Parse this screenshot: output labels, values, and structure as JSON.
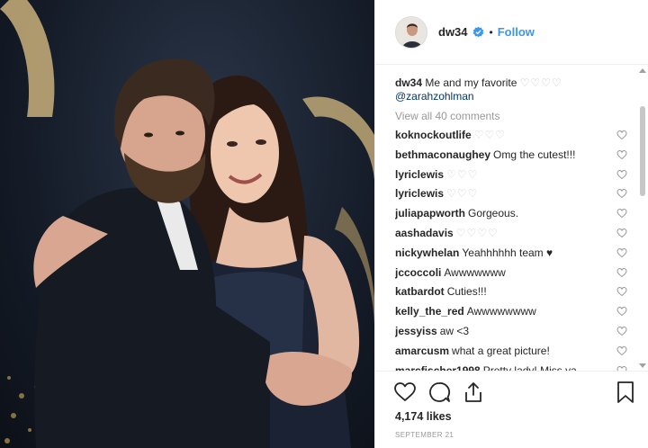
{
  "header": {
    "username": "dw34",
    "separator": "•",
    "follow_label": "Follow"
  },
  "caption": {
    "username": "dw34",
    "text": "Me and my favorite",
    "emoji": "♡♡♡♡",
    "mention": "@zarahzohlman"
  },
  "view_all": "View all 40 comments",
  "comments": [
    {
      "user": "koknockoutlife",
      "text": "♡♡♡",
      "faded": true
    },
    {
      "user": "bethmaconaughey",
      "text": "Omg the cutest!!!",
      "faded": false
    },
    {
      "user": "lyriclewis",
      "text": "♡♡♡",
      "faded": true
    },
    {
      "user": "lyriclewis",
      "text": "♡♡♡",
      "faded": true
    },
    {
      "user": "juliapapworth",
      "text": "Gorgeous.",
      "faded": false
    },
    {
      "user": "aashadavis",
      "text": "♡♡♡♡",
      "faded": true
    },
    {
      "user": "nickywhelan",
      "text": "Yeahhhhhh team ♥",
      "faded": false
    },
    {
      "user": "jccoccoli",
      "text": "Awwwwwww",
      "faded": false
    },
    {
      "user": "katbardot",
      "text": "Cuties!!!",
      "faded": false
    },
    {
      "user": "kelly_the_red",
      "text": "Awwwwwwww",
      "faded": false
    },
    {
      "user": "jessyiss",
      "text": "aw <3",
      "faded": false
    },
    {
      "user": "amarcusm",
      "text": "what a great picture!",
      "faded": false
    },
    {
      "user": "marcfischer1998",
      "text": "Pretty lady! Miss ya",
      "faded": false
    }
  ],
  "actions": {
    "likes": "4,174 likes",
    "date": "SEPTEMBER 21"
  },
  "colors": {
    "link_blue": "#3897f0",
    "verified_blue": "#3897f0",
    "muted": "#999999",
    "border": "#efefef"
  }
}
